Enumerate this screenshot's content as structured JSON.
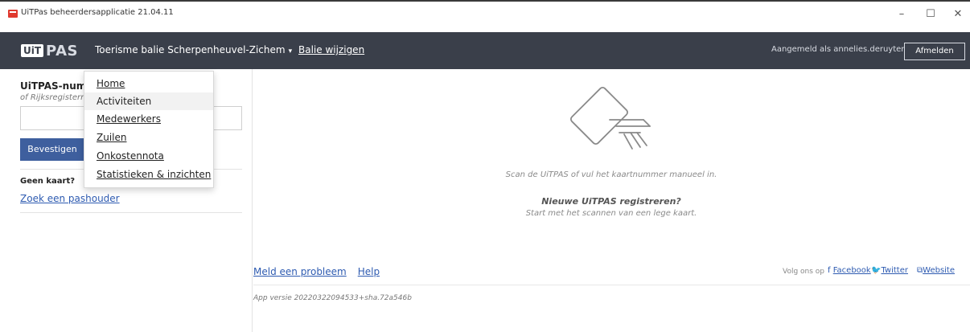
{
  "window": {
    "title": "UiTPas beheerdersapplicatie 21.04.11",
    "controls": {
      "minimize": "–",
      "maximize": "☐",
      "close": "✕"
    },
    "icon": "uitpas-app-icon"
  },
  "navbar": {
    "logo_uit": "UiT",
    "logo_pas": "PAS",
    "balie": "Toerisme balie Scherpenheuvel-Zichem",
    "balie_caret": "▾",
    "balie_wijzigen": "Balie wijzigen",
    "aangemeld": "Aangemeld als annelies.deruyter",
    "afmelden": "Afmelden",
    "colors": {
      "background": "#3a3f4a",
      "text": "#ffffff"
    }
  },
  "menu": {
    "items": [
      {
        "label": "Home",
        "style": "link"
      },
      {
        "label": "Activiteiten",
        "style": "active"
      },
      {
        "label": "Medewerkers",
        "style": "link"
      },
      {
        "label": "Zuilen",
        "style": "link"
      },
      {
        "label": "Onkostennota",
        "style": "link"
      },
      {
        "label": "Statistieken & inzichten",
        "style": "link"
      }
    ]
  },
  "left": {
    "uitpas_label": "UiTPAS-numm",
    "rijks_label": "of Rijksregisterr",
    "input_value": "",
    "bevestigen": "Bevestigen",
    "geen_kaart": "Geen kaart?",
    "zoek": "Zoek een pashouder"
  },
  "main": {
    "scan_text": "Scan de UiTPAS of vul het kaartnummer manueel in.",
    "nieuwe": "Nieuwe UiTPAS registreren?",
    "start": "Start met het scannen van een lege kaart.",
    "illustration_icon": "card-scan-icon"
  },
  "footer": {
    "meld": "Meld een probleem",
    "help": "Help",
    "volg": "Volg ons op",
    "facebook": "Facebook",
    "twitter": "Twitter",
    "website": "Website",
    "version": "App versie 20220322094533+sha.72a546b"
  },
  "colors": {
    "accent": "#3e5f9e",
    "link": "#2e5bb1"
  }
}
